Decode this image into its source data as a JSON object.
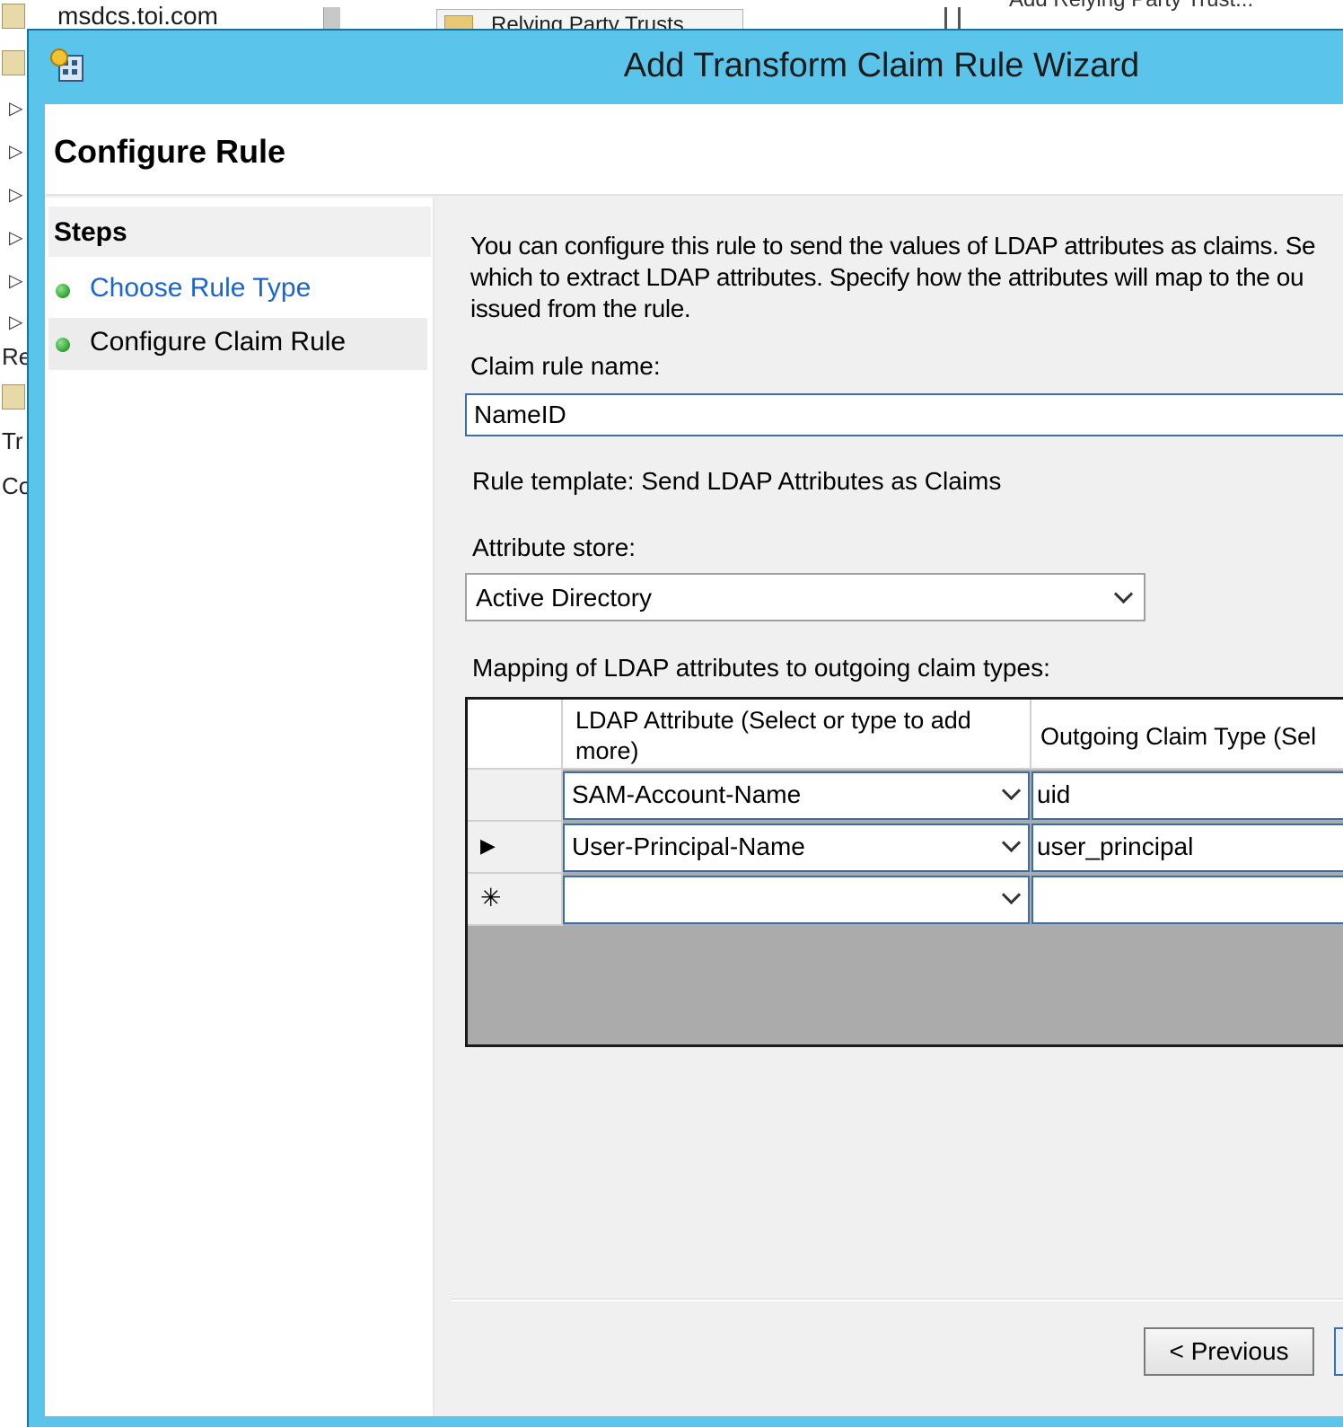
{
  "background": {
    "domain_text": "msdcs.toi.com",
    "tab_label": "Relying Party Trusts",
    "tree_fragments": [
      "Re",
      "Tr",
      "Co"
    ],
    "right_text": "Add Relying Party Trust..."
  },
  "window": {
    "title": "Add Transform Claim Rule Wizard",
    "accent_color": "#5bc4ea"
  },
  "header": {
    "heading": "Configure Rule"
  },
  "steps": {
    "heading": "Steps",
    "items": [
      {
        "label": "Choose Rule Type",
        "state": "link"
      },
      {
        "label": "Configure Claim Rule",
        "state": "current"
      }
    ]
  },
  "content": {
    "description": "You can configure this rule to send the values of LDAP attributes as claims. Se\nwhich to extract LDAP attributes. Specify how the attributes will map to the ou\nissued from the rule.",
    "claim_rule_name_label": "Claim rule name:",
    "claim_rule_name_value": "NameID",
    "rule_template": "Rule template: Send LDAP Attributes as Claims",
    "attribute_store_label": "Attribute store:",
    "attribute_store_value": "Active Directory",
    "mapping_label": "Mapping of LDAP attributes to outgoing claim types:"
  },
  "grid": {
    "columns": [
      "LDAP Attribute (Select or type to add more)",
      "Outgoing Claim Type (Sel"
    ],
    "rows": [
      {
        "marker": "",
        "ldap": "SAM-Account-Name",
        "claim": "uid"
      },
      {
        "marker": "▶",
        "ldap": "User-Principal-Name",
        "claim": "user_principal"
      },
      {
        "marker": "✳",
        "ldap": "",
        "claim": ""
      }
    ]
  },
  "footer": {
    "previous_label": "< Previous"
  }
}
